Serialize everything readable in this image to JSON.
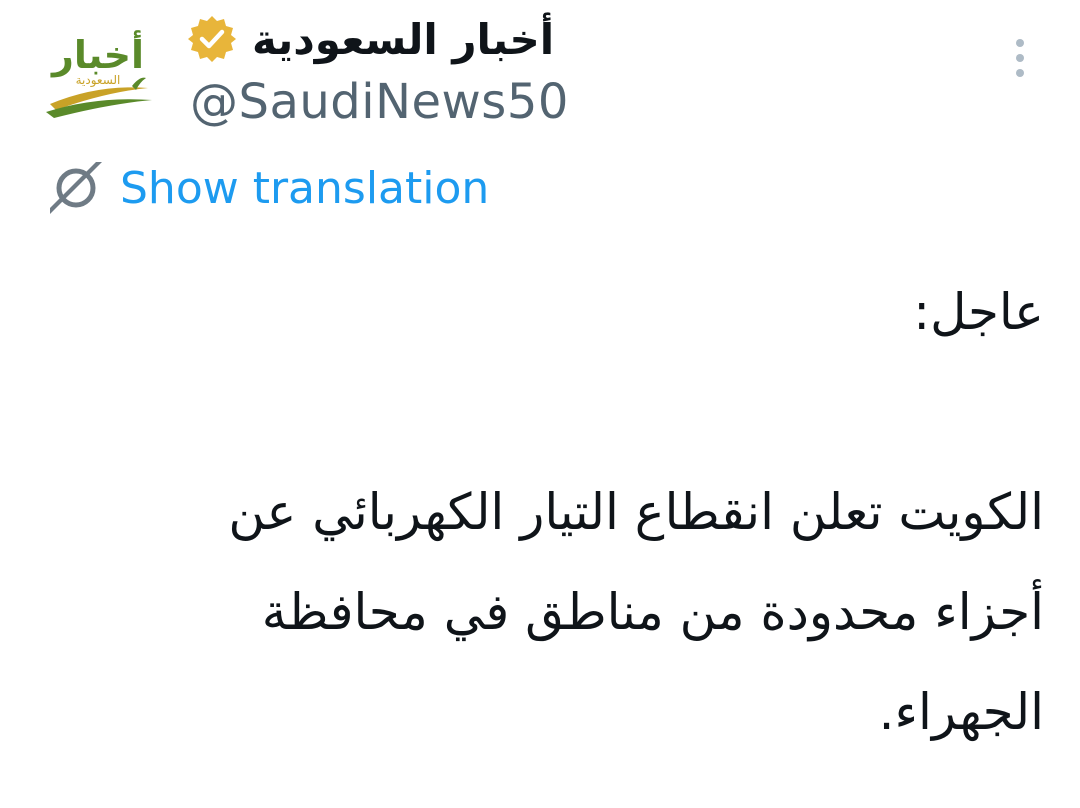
{
  "tweet": {
    "author": {
      "display_name": "أخبار السعودية",
      "handle": "@SaudiNews50",
      "verified": true,
      "verified_badge_color": "#e8b53a",
      "avatar": {
        "logo_text": "أخبار",
        "logo_subtext": "السعودية",
        "icon": "saudi-news-logo"
      }
    },
    "actions": {
      "more_icon": "vertical-ellipsis-icon"
    },
    "translation": {
      "label": "Show translation",
      "icon": "translate-icon"
    },
    "body": {
      "heading": "عاجل:",
      "paragraph": "الكويت تعلن انقطاع التيار الكهربائي عن أجزاء محدودة من مناطق في محافظة الجهراء."
    }
  },
  "colors": {
    "link_blue": "#1d9bf0",
    "text_primary": "#0f1419",
    "text_secondary": "#536471",
    "icon_gray": "#aebbc6",
    "logo_green": "#5a8a2a",
    "logo_gold": "#c9a227"
  }
}
